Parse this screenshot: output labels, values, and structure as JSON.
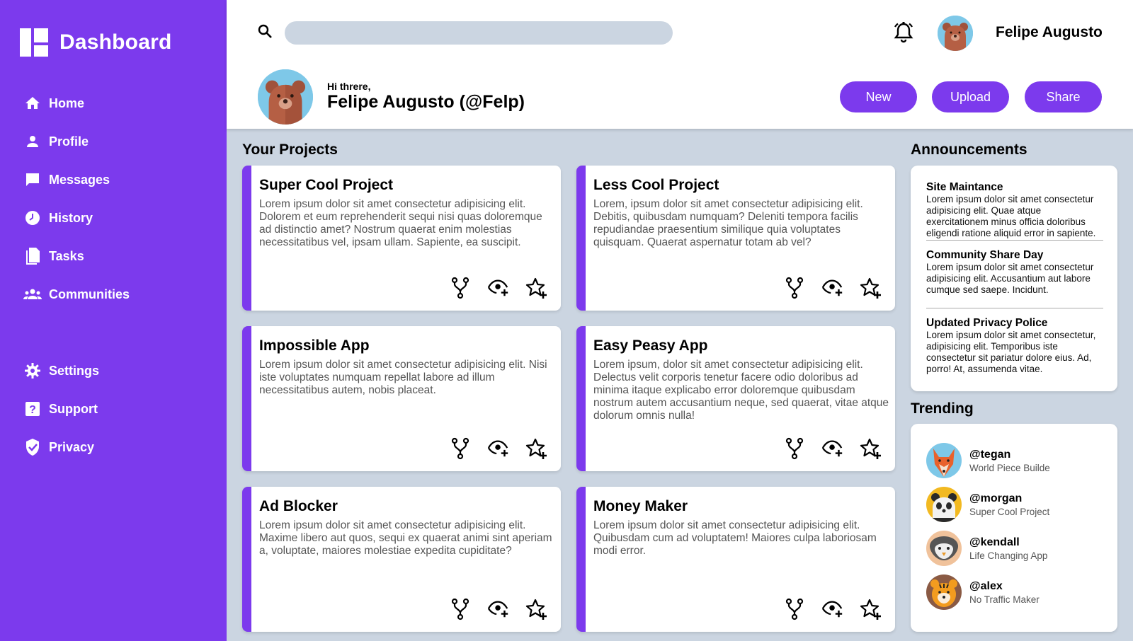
{
  "app": {
    "title": "Dashboard"
  },
  "sidebar": {
    "items": [
      {
        "label": "Home",
        "icon": "home-icon"
      },
      {
        "label": "Profile",
        "icon": "person-icon"
      },
      {
        "label": "Messages",
        "icon": "chat-icon"
      },
      {
        "label": "History",
        "icon": "clock-icon"
      },
      {
        "label": "Tasks",
        "icon": "document-icon"
      },
      {
        "label": "Communities",
        "icon": "group-icon"
      },
      {
        "label": "Settings",
        "icon": "gear-icon"
      },
      {
        "label": "Support",
        "icon": "help-icon"
      },
      {
        "label": "Privacy",
        "icon": "shield-icon"
      }
    ]
  },
  "header": {
    "search": {
      "value": "",
      "placeholder": ""
    },
    "username": "Felipe Augusto",
    "greeting": "Hi threre,",
    "full_name": "Felipe Augusto (@Felp)",
    "buttons": {
      "new": "New",
      "upload": "Upload",
      "share": "Share"
    }
  },
  "projects": {
    "title": "Your Projects",
    "items": [
      {
        "title": "Super Cool Project",
        "desc": "Lorem ipsum dolor sit amet consectetur adipisicing elit. Dolorem et eum reprehenderit sequi nisi quas doloremque ad distinctio amet? Nostrum quaerat enim molestias necessitatibus vel, ipsam ullam. Sapiente, ea suscipit."
      },
      {
        "title": "Less Cool Project",
        "desc": "Lorem, ipsum dolor sit amet consectetur adipisicing elit. Debitis, quibusdam numquam? Deleniti tempora facilis repudiandae praesentium similique quia voluptates quisquam. Quaerat aspernatur totam ab vel?"
      },
      {
        "title": "Impossible App",
        "desc": "Lorem ipsum dolor sit amet consectetur adipisicing elit. Nisi iste voluptates numquam repellat labore ad illum necessitatibus autem, nobis placeat."
      },
      {
        "title": "Easy Peasy App",
        "desc": "Lorem ipsum, dolor sit amet consectetur adipisicing elit. Delectus velit corporis tenetur facere odio doloribus ad minima itaque explicabo error doloremque quibusdam nostrum autem accusantium neque, sed quaerat, vitae atque dolorum omnis nulla!"
      },
      {
        "title": "Ad Blocker",
        "desc": "Lorem ipsum dolor sit amet consectetur adipisicing elit. Maxime libero aut quos, sequi ex quaerat animi sint aperiam a, voluptate, maiores molestiae expedita cupiditate?"
      },
      {
        "title": "Money Maker",
        "desc": "Lorem ipsum dolor sit amet consectetur adipisicing elit. Quibusdam cum ad voluptatem! Maiores culpa laboriosam modi error."
      }
    ]
  },
  "announcements": {
    "title": "Announcements",
    "items": [
      {
        "title": "Site Maintance",
        "body": "Lorem ipsum dolor sit amet consectetur adipisicing elit. Quae atque exercitationem minus officia doloribus eligendi ratione aliquid error in sapiente."
      },
      {
        "title": "Community Share Day",
        "body": "Lorem ipsum dolor sit amet consectetur adipisicing elit. Accusantium aut labore cumque sed saepe. Incidunt."
      },
      {
        "title": "Updated Privacy Police",
        "body": "Lorem ipsum dolor sit amet consectetur, adipisicing elit. Temporibus iste consectetur sit pariatur dolore eius. Ad, porro! At, assumenda vitae."
      }
    ]
  },
  "trending": {
    "title": "Trending",
    "items": [
      {
        "handle": "@tegan",
        "project": "World Piece Builde"
      },
      {
        "handle": "@morgan",
        "project": "Super Cool Project"
      },
      {
        "handle": "@kendall",
        "project": "Life Changing App"
      },
      {
        "handle": "@alex",
        "project": "No Traffic Maker"
      }
    ]
  },
  "colors": {
    "accent": "#7c3aed",
    "background": "#cbd5e1"
  }
}
